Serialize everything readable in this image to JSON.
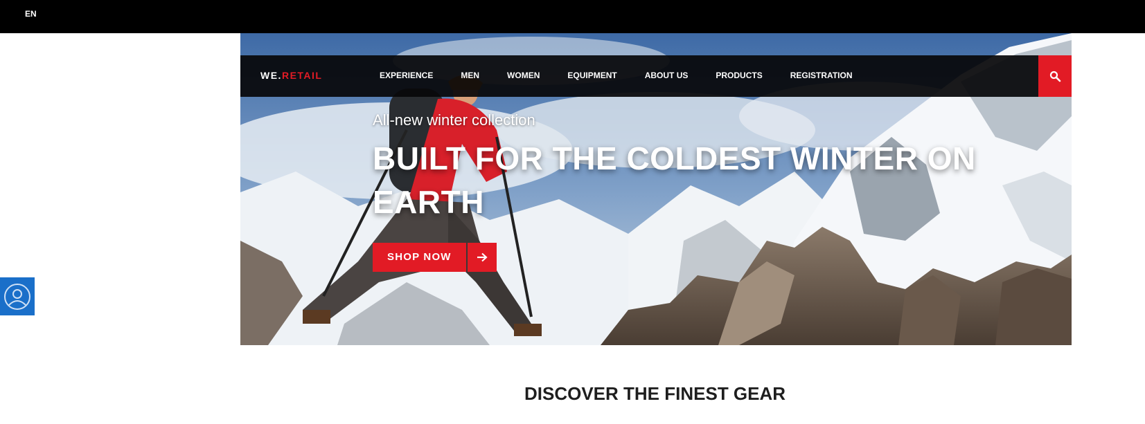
{
  "topbar": {
    "language": "EN"
  },
  "header": {
    "logo": {
      "prefix": "WE.",
      "suffix": "RETAIL"
    },
    "nav": [
      {
        "label": "EXPERIENCE"
      },
      {
        "label": "MEN"
      },
      {
        "label": "WOMEN"
      },
      {
        "label": "EQUIPMENT"
      },
      {
        "label": "ABOUT US"
      },
      {
        "label": "PRODUCTS"
      },
      {
        "label": "REGISTRATION"
      }
    ],
    "search_icon": "search-icon"
  },
  "hero": {
    "kicker": "All-new winter collection",
    "headline": "BUILT FOR THE COLDEST WINTER ON EARTH",
    "cta": {
      "label": "SHOP NOW",
      "icon": "arrow-right-icon"
    }
  },
  "section": {
    "title": "DISCOVER THE FINEST GEAR"
  },
  "floating": {
    "profile_icon": "user-profile-icon"
  },
  "colors": {
    "accent": "#e21b25",
    "topbar": "#000000",
    "profile_button": "#1a6fc9"
  }
}
